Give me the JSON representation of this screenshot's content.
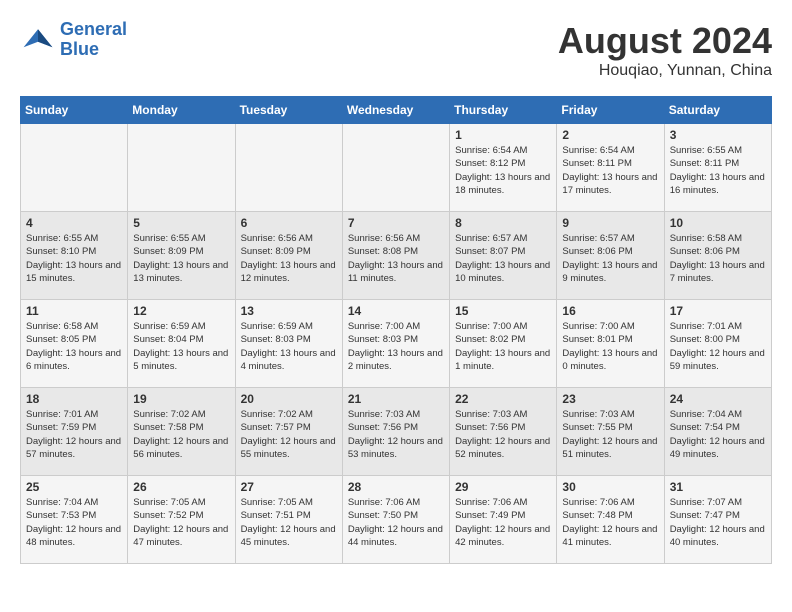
{
  "logo": {
    "line1": "General",
    "line2": "Blue"
  },
  "title": "August 2024",
  "location": "Houqiao, Yunnan, China",
  "weekdays": [
    "Sunday",
    "Monday",
    "Tuesday",
    "Wednesday",
    "Thursday",
    "Friday",
    "Saturday"
  ],
  "weeks": [
    [
      {
        "day": "",
        "info": ""
      },
      {
        "day": "",
        "info": ""
      },
      {
        "day": "",
        "info": ""
      },
      {
        "day": "",
        "info": ""
      },
      {
        "day": "1",
        "info": "Sunrise: 6:54 AM\nSunset: 8:12 PM\nDaylight: 13 hours and 18 minutes."
      },
      {
        "day": "2",
        "info": "Sunrise: 6:54 AM\nSunset: 8:11 PM\nDaylight: 13 hours and 17 minutes."
      },
      {
        "day": "3",
        "info": "Sunrise: 6:55 AM\nSunset: 8:11 PM\nDaylight: 13 hours and 16 minutes."
      }
    ],
    [
      {
        "day": "4",
        "info": "Sunrise: 6:55 AM\nSunset: 8:10 PM\nDaylight: 13 hours and 15 minutes."
      },
      {
        "day": "5",
        "info": "Sunrise: 6:55 AM\nSunset: 8:09 PM\nDaylight: 13 hours and 13 minutes."
      },
      {
        "day": "6",
        "info": "Sunrise: 6:56 AM\nSunset: 8:09 PM\nDaylight: 13 hours and 12 minutes."
      },
      {
        "day": "7",
        "info": "Sunrise: 6:56 AM\nSunset: 8:08 PM\nDaylight: 13 hours and 11 minutes."
      },
      {
        "day": "8",
        "info": "Sunrise: 6:57 AM\nSunset: 8:07 PM\nDaylight: 13 hours and 10 minutes."
      },
      {
        "day": "9",
        "info": "Sunrise: 6:57 AM\nSunset: 8:06 PM\nDaylight: 13 hours and 9 minutes."
      },
      {
        "day": "10",
        "info": "Sunrise: 6:58 AM\nSunset: 8:06 PM\nDaylight: 13 hours and 7 minutes."
      }
    ],
    [
      {
        "day": "11",
        "info": "Sunrise: 6:58 AM\nSunset: 8:05 PM\nDaylight: 13 hours and 6 minutes."
      },
      {
        "day": "12",
        "info": "Sunrise: 6:59 AM\nSunset: 8:04 PM\nDaylight: 13 hours and 5 minutes."
      },
      {
        "day": "13",
        "info": "Sunrise: 6:59 AM\nSunset: 8:03 PM\nDaylight: 13 hours and 4 minutes."
      },
      {
        "day": "14",
        "info": "Sunrise: 7:00 AM\nSunset: 8:03 PM\nDaylight: 13 hours and 2 minutes."
      },
      {
        "day": "15",
        "info": "Sunrise: 7:00 AM\nSunset: 8:02 PM\nDaylight: 13 hours and 1 minute."
      },
      {
        "day": "16",
        "info": "Sunrise: 7:00 AM\nSunset: 8:01 PM\nDaylight: 13 hours and 0 minutes."
      },
      {
        "day": "17",
        "info": "Sunrise: 7:01 AM\nSunset: 8:00 PM\nDaylight: 12 hours and 59 minutes."
      }
    ],
    [
      {
        "day": "18",
        "info": "Sunrise: 7:01 AM\nSunset: 7:59 PM\nDaylight: 12 hours and 57 minutes."
      },
      {
        "day": "19",
        "info": "Sunrise: 7:02 AM\nSunset: 7:58 PM\nDaylight: 12 hours and 56 minutes."
      },
      {
        "day": "20",
        "info": "Sunrise: 7:02 AM\nSunset: 7:57 PM\nDaylight: 12 hours and 55 minutes."
      },
      {
        "day": "21",
        "info": "Sunrise: 7:03 AM\nSunset: 7:56 PM\nDaylight: 12 hours and 53 minutes."
      },
      {
        "day": "22",
        "info": "Sunrise: 7:03 AM\nSunset: 7:56 PM\nDaylight: 12 hours and 52 minutes."
      },
      {
        "day": "23",
        "info": "Sunrise: 7:03 AM\nSunset: 7:55 PM\nDaylight: 12 hours and 51 minutes."
      },
      {
        "day": "24",
        "info": "Sunrise: 7:04 AM\nSunset: 7:54 PM\nDaylight: 12 hours and 49 minutes."
      }
    ],
    [
      {
        "day": "25",
        "info": "Sunrise: 7:04 AM\nSunset: 7:53 PM\nDaylight: 12 hours and 48 minutes."
      },
      {
        "day": "26",
        "info": "Sunrise: 7:05 AM\nSunset: 7:52 PM\nDaylight: 12 hours and 47 minutes."
      },
      {
        "day": "27",
        "info": "Sunrise: 7:05 AM\nSunset: 7:51 PM\nDaylight: 12 hours and 45 minutes."
      },
      {
        "day": "28",
        "info": "Sunrise: 7:06 AM\nSunset: 7:50 PM\nDaylight: 12 hours and 44 minutes."
      },
      {
        "day": "29",
        "info": "Sunrise: 7:06 AM\nSunset: 7:49 PM\nDaylight: 12 hours and 42 minutes."
      },
      {
        "day": "30",
        "info": "Sunrise: 7:06 AM\nSunset: 7:48 PM\nDaylight: 12 hours and 41 minutes."
      },
      {
        "day": "31",
        "info": "Sunrise: 7:07 AM\nSunset: 7:47 PM\nDaylight: 12 hours and 40 minutes."
      }
    ]
  ]
}
